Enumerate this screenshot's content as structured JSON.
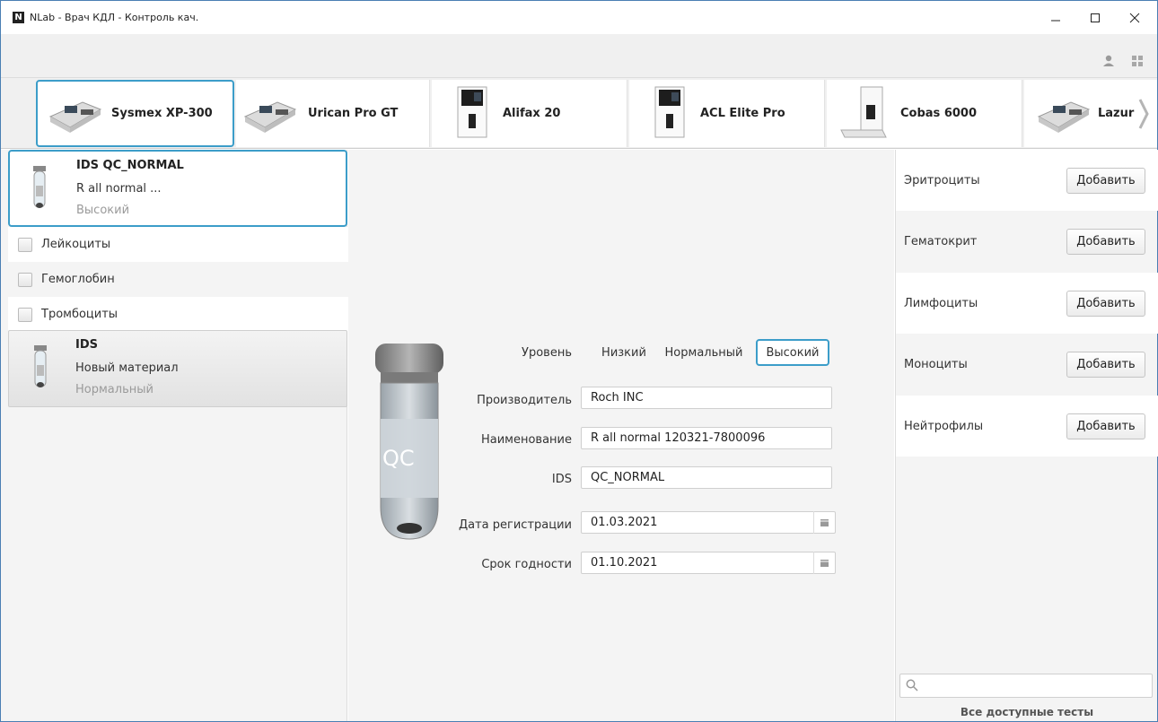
{
  "window": {
    "title": "NLab - Врач КДЛ - Контроль кач.",
    "minimize": "—",
    "maximize": "☐",
    "close": "✕"
  },
  "devices": [
    {
      "name": "Sysmex XP-300",
      "selected": true
    },
    {
      "name": "Urican Pro GT"
    },
    {
      "name": "Alifax 20"
    },
    {
      "name": "ACL Elite Pro"
    },
    {
      "name": "Cobas 6000"
    },
    {
      "name": "Lazur"
    }
  ],
  "materials": [
    {
      "title": "IDS QC_NORMAL",
      "subtitle": "R all normal ...",
      "level": "Высокий",
      "selected": true
    },
    {
      "title": "IDS",
      "subtitle": "Новый материал",
      "level": "Нормальный"
    }
  ],
  "tests_checked": [
    "Лейкоциты",
    "Гемоглобин",
    "Тромбоциты"
  ],
  "form": {
    "level_label": "Уровень",
    "levels": [
      "Низкий",
      "Нормальный",
      "Высокий"
    ],
    "selected_level": "Высокий",
    "manufacturer_label": "Производитель",
    "manufacturer": "Roch INC",
    "name_label": "Наименование",
    "name": "R all normal 120321-7800096",
    "ids_label": "IDS",
    "ids": "QC_NORMAL",
    "reg_date_label": "Дата регистрации",
    "reg_date": "01.03.2021",
    "expiry_label": "Срок годности",
    "expiry": "01.10.2021",
    "tube_text": "QC"
  },
  "available_tests": [
    {
      "name": "Эритроциты",
      "button": "Добавить"
    },
    {
      "name": "Гематокрит",
      "button": "Добавить"
    },
    {
      "name": "Лимфоциты",
      "button": "Добавить"
    },
    {
      "name": "Моноциты",
      "button": "Добавить"
    },
    {
      "name": "Нейтрофилы",
      "button": "Добавить"
    }
  ],
  "all_tests_label": "Все доступные тесты",
  "colors": {
    "accent": "#3c9dc9",
    "panel": "#f4f4f4"
  }
}
